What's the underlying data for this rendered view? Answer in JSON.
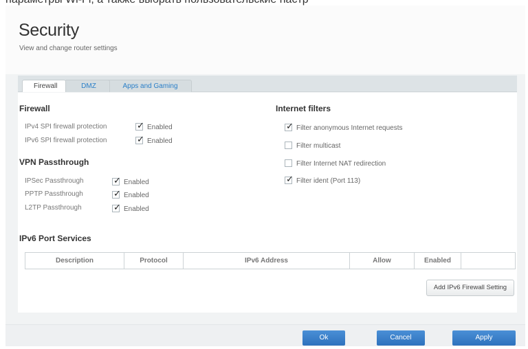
{
  "header": {
    "title": "Security",
    "subtitle": "View and change router settings"
  },
  "top_text": "нараметры Wi-Fi, а также выбрать пользовательские настр",
  "tabs": [
    {
      "label": "Firewall",
      "active": true
    },
    {
      "label": "DMZ",
      "active": false
    },
    {
      "label": "Apps and Gaming",
      "active": false
    }
  ],
  "firewall": {
    "title": "Firewall",
    "rows": [
      {
        "label": "IPv4 SPI firewall protection",
        "checked": true,
        "option": "Enabled"
      },
      {
        "label": "IPv6 SPI firewall protection",
        "checked": true,
        "option": "Enabled"
      }
    ]
  },
  "vpn": {
    "title": "VPN Passthrough",
    "rows": [
      {
        "label": "IPSec Passthrough",
        "checked": true,
        "option": "Enabled"
      },
      {
        "label": "PPTP Passthrough",
        "checked": true,
        "option": "Enabled"
      },
      {
        "label": "L2TP Passthrough",
        "checked": true,
        "option": "Enabled"
      }
    ]
  },
  "internet_filters": {
    "title": "Internet filters",
    "items": [
      {
        "label": "Filter anonymous Internet requests",
        "checked": true
      },
      {
        "label": "Filter multicast",
        "checked": false
      },
      {
        "label": "Filter Internet NAT redirection",
        "checked": false
      },
      {
        "label": "Filter ident (Port 113)",
        "checked": true
      }
    ]
  },
  "ipv6_services": {
    "title": "IPv6 Port Services",
    "columns": [
      "Description",
      "Protocol",
      "IPv6 Address",
      "Allow",
      "Enabled",
      ""
    ],
    "add_button": "Add IPv6 Firewall Setting"
  },
  "footer": {
    "ok": "Ok",
    "cancel": "Cancel",
    "apply": "Apply"
  },
  "colors": {
    "accent": "#2e72bd",
    "panel_bg": "#f1f3f4",
    "tab_link": "#2a7fc8"
  },
  "icons": {
    "close": "close-icon",
    "check": "checkmark-icon"
  }
}
